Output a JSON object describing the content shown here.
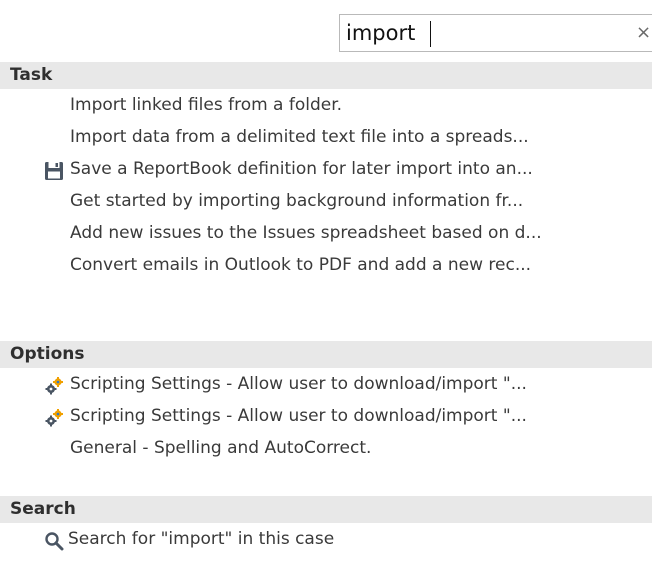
{
  "search": {
    "value": "import",
    "clear_symbol": "×"
  },
  "sections": {
    "task": {
      "header": "Task",
      "items": [
        "Import linked files from a folder.",
        "Import data from a delimited text file into a spreads...",
        "Save a ReportBook definition for later import into an...",
        "Get started by importing background information fr...",
        "Add new issues to the Issues spreadsheet based on d...",
        "Convert emails in Outlook to PDF and add a new rec..."
      ]
    },
    "options": {
      "header": "Options",
      "items": [
        "Scripting Settings - Allow user to download/import \"...",
        "Scripting Settings - Allow user to download/import \"...",
        "General - Spelling and AutoCorrect."
      ]
    },
    "search": {
      "header": "Search",
      "items": [
        "Search for \"import\" in this case"
      ]
    }
  },
  "icons": {
    "save": "floppy-disk-icon",
    "settings": "gears-icon",
    "search": "magnifier-icon"
  },
  "colors": {
    "header_bg": "#e8e8e8",
    "icon_dark": "#4a5563",
    "gear_orange": "#f0a000",
    "gear_blue": "#2f79c8"
  }
}
